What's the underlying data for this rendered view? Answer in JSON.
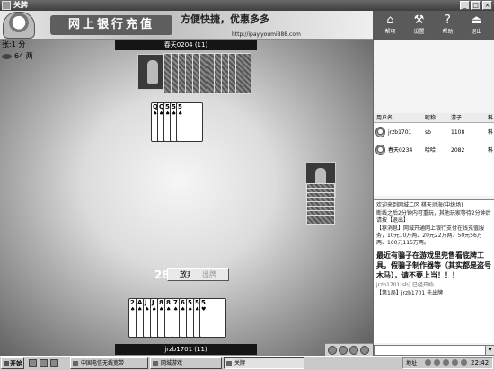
{
  "window": {
    "title": "关牌"
  },
  "banner": {
    "main": "网上银行充值",
    "slogan": "方便快捷，优惠多多",
    "url": "http://ipay.youmi888.com"
  },
  "toolbar": {
    "items": [
      {
        "label": "帮项",
        "icon": "home-icon"
      },
      {
        "label": "设置",
        "icon": "settings-icon"
      },
      {
        "label": "帮助",
        "icon": "help-icon"
      },
      {
        "label": "退出",
        "icon": "exit-icon"
      }
    ]
  },
  "score": {
    "line1": "张:1 分",
    "line2": "64 两"
  },
  "players": {
    "top": "春天0204 (11)",
    "bottom": "jrzb1701 (11)"
  },
  "table": {
    "played_cards": [
      {
        "rank": "Q",
        "suit": "♠"
      },
      {
        "rank": "Q",
        "suit": "♠"
      },
      {
        "rank": "5",
        "suit": "♠"
      },
      {
        "rank": "5",
        "suit": "♠"
      },
      {
        "rank": "5",
        "suit": "♠"
      }
    ],
    "timer": "28",
    "pass_button": "放弃",
    "play_button": "出牌"
  },
  "hand": {
    "cards": [
      {
        "rank": "2",
        "suit": "♠"
      },
      {
        "rank": "A",
        "suit": "♠"
      },
      {
        "rank": "J",
        "suit": "♠"
      },
      {
        "rank": "J",
        "suit": "♠"
      },
      {
        "rank": "8",
        "suit": "♠"
      },
      {
        "rank": "8",
        "suit": "♠"
      },
      {
        "rank": "7",
        "suit": "♠"
      },
      {
        "rank": "6",
        "suit": "♠"
      },
      {
        "rank": "5",
        "suit": "♠"
      },
      {
        "rank": "5",
        "suit": "♠"
      },
      {
        "rank": "5",
        "suit": "♥"
      }
    ]
  },
  "user_list": {
    "headers": [
      "用户名",
      "昵称",
      "游子",
      "科"
    ],
    "rows": [
      {
        "name": "jrzb1701",
        "nick": "sb",
        "value": "1108",
        "extra": "科"
      },
      {
        "name": "春天0234",
        "nick": "哈哈",
        "value": "2082",
        "extra": "科"
      }
    ]
  },
  "chat": {
    "lines": [
      "欢迎来到网城二区 棋天冠海(中级场)",
      "断线之后2分钟内可重玩，其他玩家等待2分钟后请按【退出】",
      "【荐消息】网城开通网上银行支付在线充值服务，10元10万两、20元22万两、50元56万两、100元115万两。"
    ],
    "warning": "最近有骗子在游戏里兜售看底牌工具，假骗子制作器等（其实都是盗号木马），请不要上当！！！",
    "footer": [
      "jrzb1701[sb] 已经开始",
      "【第1局】jrzb1701 先出牌"
    ]
  },
  "taskbar": {
    "start": "开始",
    "buttons": [
      "中国电信无线宽带",
      "网城游戏",
      "关牌"
    ],
    "address_label": "地址",
    "clock": "22:42"
  }
}
